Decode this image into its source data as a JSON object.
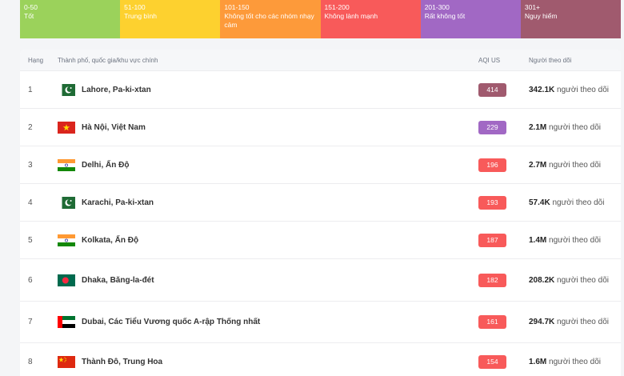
{
  "aqi_scale": [
    {
      "range": "0-50",
      "label": "Tốt",
      "color": "#9bd25b"
    },
    {
      "range": "51-100",
      "label": "Trung bình",
      "color": "#fdd12f"
    },
    {
      "range": "101-150",
      "label": "Không tốt cho các nhóm nhạy cảm",
      "color": "#fd9a3a"
    },
    {
      "range": "151-200",
      "label": "Không lành mạnh",
      "color": "#f85a5a"
    },
    {
      "range": "201-300",
      "label": "Rất không tốt",
      "color": "#a168c4"
    },
    {
      "range": "301+",
      "label": "Nguy hiểm",
      "color": "#a05a6e"
    }
  ],
  "table": {
    "headers": {
      "rank": "Hạng",
      "city": "Thành phố, quốc gia/khu vực chính",
      "aqi": "AQI US",
      "followers": "Người theo dõi"
    },
    "rows": [
      {
        "rank": "1",
        "city": "Lahore, Pa-ki-xtan",
        "flag": "pakistan-flag-icon",
        "aqi": "414",
        "aqi_color": "#a05a6e",
        "followers_value": "342.1K",
        "followers_suffix": "người theo dõi"
      },
      {
        "rank": "2",
        "city": "Hà Nội, Việt Nam",
        "flag": "vietnam-flag-icon",
        "aqi": "229",
        "aqi_color": "#a168c4",
        "followers_value": "2.1M",
        "followers_suffix": "người theo dõi"
      },
      {
        "rank": "3",
        "city": "Delhi, Ấn Độ",
        "flag": "india-flag-icon",
        "aqi": "196",
        "aqi_color": "#f85a5a",
        "followers_value": "2.7M",
        "followers_suffix": "người theo dõi"
      },
      {
        "rank": "4",
        "city": "Karachi, Pa-ki-xtan",
        "flag": "pakistan-flag-icon",
        "aqi": "193",
        "aqi_color": "#f85a5a",
        "followers_value": "57.4K",
        "followers_suffix": "người theo dõi"
      },
      {
        "rank": "5",
        "city": "Kolkata, Ấn Độ",
        "flag": "india-flag-icon",
        "aqi": "187",
        "aqi_color": "#f85a5a",
        "followers_value": "1.4M",
        "followers_suffix": "người theo dõi"
      },
      {
        "rank": "6",
        "city": "Dhaka, Băng-la-đét",
        "flag": "bangladesh-flag-icon",
        "aqi": "182",
        "aqi_color": "#f85a5a",
        "followers_value": "208.2K",
        "followers_suffix": "người theo dõi"
      },
      {
        "rank": "7",
        "city": "Dubai, Các Tiểu Vương quốc A-rập Thống nhất",
        "flag": "uae-flag-icon",
        "aqi": "161",
        "aqi_color": "#f85a5a",
        "followers_value": "294.7K",
        "followers_suffix": "người theo dõi"
      },
      {
        "rank": "8",
        "city": "Thành Đô, Trung Hoa",
        "flag": "china-flag-icon",
        "aqi": "154",
        "aqi_color": "#f85a5a",
        "followers_value": "1.6M",
        "followers_suffix": "người theo dõi"
      }
    ]
  }
}
